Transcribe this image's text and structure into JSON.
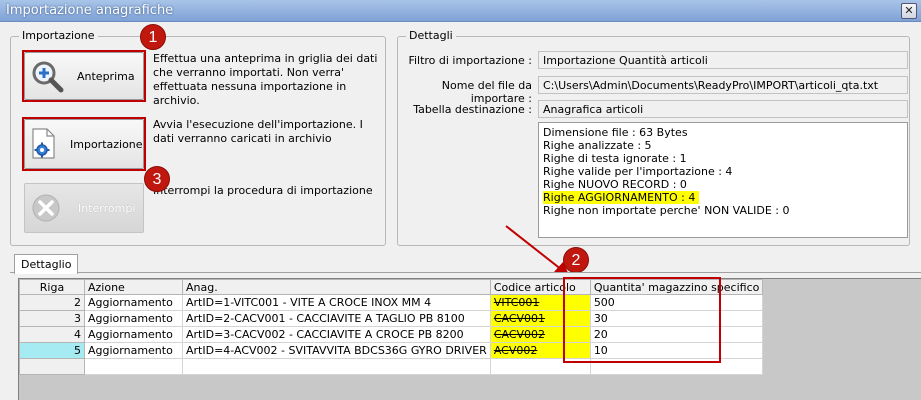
{
  "window": {
    "title": "Importazione anagrafiche",
    "close_label": "✕"
  },
  "importazione": {
    "legend": "Importazione",
    "anteprima": {
      "label": "Anteprima",
      "description": "Effettua una anteprima in griglia dei dati che verranno importati. Non verra' effettuata nessuna importazione in archivio."
    },
    "importa": {
      "label": "Importazione",
      "description": "Avvia l'esecuzione dell'importazione. I dati verranno caricati in archivio"
    },
    "interrompi": {
      "label": "Interrompi",
      "description": "Interrompi la procedura di importazione"
    }
  },
  "badges": [
    "1",
    "2",
    "3"
  ],
  "dettagli": {
    "legend": "Dettagli",
    "fields": [
      {
        "label": "Filtro di importazione :",
        "value": "Importazione Quantità articoli"
      },
      {
        "label": "Nome del file da importare :",
        "value": "C:\\Users\\Admin\\Documents\\ReadyPro\\IMPORT\\articoli_qta.txt"
      },
      {
        "label": "Tabella destinazione :",
        "value": "Anagrafica articoli"
      }
    ],
    "stats": [
      "Dimensione file : 63 Bytes",
      "Righe analizzate : 5",
      "Righe di testa ignorate : 1",
      "Righe valide per l'importazione : 4",
      "Righe NUOVO RECORD : 0",
      "Righe AGGIORNAMENTO  : 4",
      "Righe non importate perche' NON VALIDE : 0"
    ]
  },
  "tab": {
    "label": "Dettaglio"
  },
  "grid": {
    "columns": [
      "Riga",
      "Azione",
      "Anag.",
      "Codice articolo",
      "Quantita' magazzino specifico"
    ],
    "rows": [
      {
        "riga": "2",
        "azione": "Aggiornamento",
        "anag": "ArtID=1-VITC001 - VITE A CROCE INOX MM 4",
        "codice": "VITC001",
        "qta": "500"
      },
      {
        "riga": "3",
        "azione": "Aggiornamento",
        "anag": "ArtID=2-CACV001 - CACCIAVITE A TAGLIO PB 8100",
        "codice": "CACV001",
        "qta": "30"
      },
      {
        "riga": "4",
        "azione": "Aggiornamento",
        "anag": "ArtID=3-CACV002 - CACCIAVITE A CROCE PB 8200",
        "codice": "CACV002",
        "qta": "20"
      },
      {
        "riga": "5",
        "azione": "Aggiornamento",
        "anag": "ArtID=4-ACV002 - SVITAVVITA BDCS36G GYRO DRIVER",
        "codice": "ACV002",
        "qta": "10"
      }
    ]
  },
  "colors": {
    "highlight": "#ffff00",
    "annotation_red": "#c00000",
    "selected_row": "#a6eaf2"
  }
}
